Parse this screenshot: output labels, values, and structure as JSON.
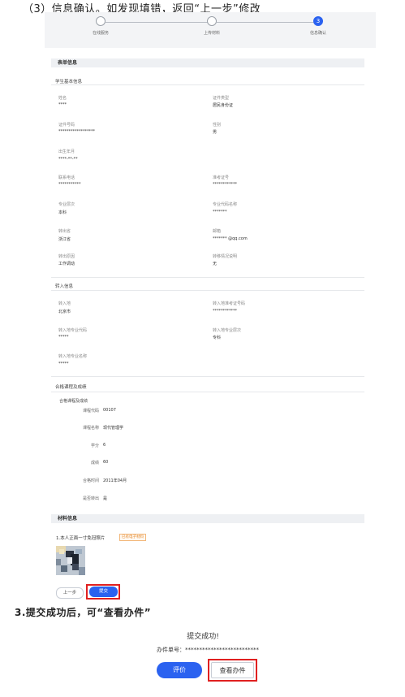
{
  "doc": {
    "heading_top": "（3）信息确认。如发现填错，返回“上一步”修改",
    "heading_3": "3.提交成功后，可“查看办件”"
  },
  "steps": [
    {
      "label": "在线服务"
    },
    {
      "label": "上传材料"
    },
    {
      "label": "信息确认",
      "number": "3"
    }
  ],
  "form": {
    "section_title": "表单信息",
    "student_title": "学生基本信息",
    "fields": [
      {
        "label": "姓名",
        "value": "****"
      },
      {
        "label": "证件类型",
        "value": "居民身份证"
      },
      {
        "label": "证件号码",
        "value": "******************"
      },
      {
        "label": "性别",
        "value": "男"
      },
      {
        "label": "出生年月",
        "value": "****-**-**"
      },
      {
        "label": "联系电话",
        "value": "***********"
      },
      {
        "label": "准考证号",
        "value": "************"
      },
      {
        "label": "专业层次",
        "value": "本科"
      },
      {
        "label": "专业代码名称",
        "value": "*******"
      },
      {
        "label": "转出省",
        "value": "浙江省"
      },
      {
        "label": "邮箱",
        "value": "******* @qq.com"
      },
      {
        "label": "转出原因",
        "value": "工作调动"
      },
      {
        "label": "转移情况说明",
        "value": "无"
      }
    ],
    "transfer_title": "转入信息",
    "transfer_fields": [
      {
        "label": "转入地",
        "value": "北京市"
      },
      {
        "label": "转入地准考证号码",
        "value": "************"
      },
      {
        "label": "转入地专业代码",
        "value": "*****"
      },
      {
        "label": "转入地专业层次",
        "value": "专科"
      },
      {
        "label": "转入地专业名称",
        "value": "*****"
      }
    ],
    "course_section": "合格课程及成绩",
    "course_sub": "合格课程及成绩",
    "course_rows": [
      {
        "label": "课程代码",
        "value": "00107"
      },
      {
        "label": "课程名称",
        "value": "现代管理学"
      },
      {
        "label": "学分",
        "value": "6"
      },
      {
        "label": "成绩",
        "value": "60"
      },
      {
        "label": "合格时间",
        "value": "2011年04月"
      },
      {
        "label": "是否转出",
        "value": "是"
      }
    ]
  },
  "materials": {
    "section_title": "材料信息",
    "item_label": "1.本人正面一寸免冠照片",
    "tag": "已有电子材料"
  },
  "buttons": {
    "prev": "上一步",
    "submit": "提交"
  },
  "success": {
    "title": "提交成功!",
    "case_line": "办件单号：**************************",
    "rate_button": "评价",
    "view_button": "查看办件"
  },
  "colors": {
    "accent": "#2b62f0",
    "highlight_box": "#e02020",
    "tag": "#e58a2e"
  }
}
